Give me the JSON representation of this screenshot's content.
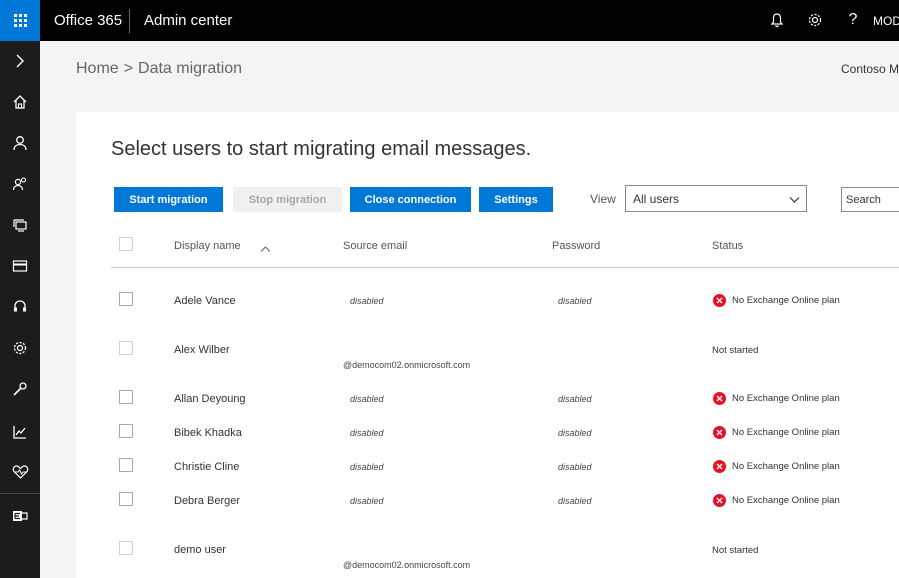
{
  "topbar": {
    "brand": "Office 365",
    "app_title": "Admin center",
    "help_glyph": "?",
    "user_initials": "MOD",
    "icons": [
      "app-launcher-icon",
      "bell-icon",
      "gear-icon",
      "help-icon"
    ]
  },
  "leftnav": {
    "icons": [
      "expand-chevron-icon",
      "home-icon",
      "user-icon",
      "groups-icon",
      "resources-icon",
      "billing-icon",
      "support-icon",
      "settings-icon",
      "setup-icon",
      "reports-icon",
      "health-icon",
      "exchange-admin-icon"
    ]
  },
  "breadcrumb": {
    "home": "Home",
    "separator": ">",
    "current": "Data migration"
  },
  "org_name": "Contoso M",
  "panel": {
    "title": "Select users to start migrating email messages."
  },
  "toolbar": {
    "start_label": "Start migration",
    "stop_label": "Stop migration",
    "close_label": "Close connection",
    "settings_label": "Settings",
    "view_label": "View",
    "view_value": "All users",
    "search_placeholder": "Search"
  },
  "table": {
    "columns": {
      "display_name": "Display name",
      "source_email": "Source email",
      "password": "Password",
      "status": "Status"
    },
    "rows": [
      {
        "name": "Adele Vance",
        "email": "disabled",
        "password": "disabled",
        "status": "No Exchange Online plan",
        "error": true
      },
      {
        "name": "Alex Wilber",
        "email": "@democom02.onmicrosoft.com",
        "password": "",
        "status": "Not started",
        "error": false
      },
      {
        "name": "Allan Deyoung",
        "email": "disabled",
        "password": "disabled",
        "status": "No Exchange Online plan",
        "error": true
      },
      {
        "name": "Bibek Khadka",
        "email": "disabled",
        "password": "disabled",
        "status": "No Exchange Online plan",
        "error": true
      },
      {
        "name": "Christie Cline",
        "email": "disabled",
        "password": "disabled",
        "status": "No Exchange Online plan",
        "error": true
      },
      {
        "name": "Debra Berger",
        "email": "disabled",
        "password": "disabled",
        "status": "No Exchange Online plan",
        "error": true
      },
      {
        "name": "demo user",
        "email": "@democom02.onmicrosoft.com",
        "password": "",
        "status": "Not started",
        "error": false
      }
    ]
  },
  "colors": {
    "accent": "#0078d7",
    "topbar": "#000000",
    "leftnav": "#1c1c1c",
    "error": "#e81123"
  }
}
